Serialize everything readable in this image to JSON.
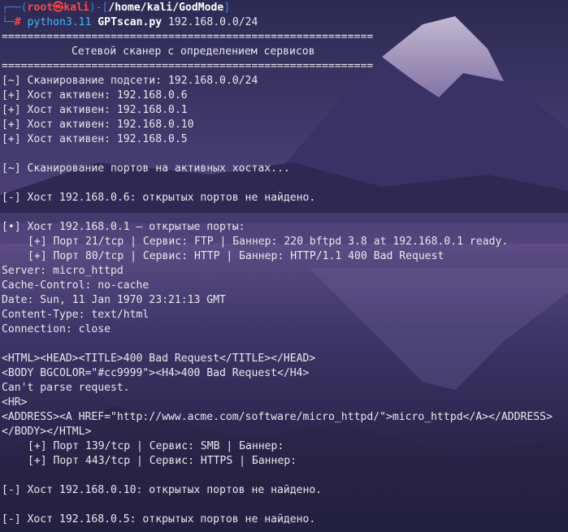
{
  "prompt": {
    "user": "root",
    "at": "㉿",
    "host": "kali",
    "cwd": "/home/kali/GodMode",
    "symbol": "#"
  },
  "command": {
    "interpreter": "python3.11",
    "script": "GPTscan.py",
    "argument": "192.168.0.0/24"
  },
  "banner": {
    "separator": "==========================================================",
    "title": "Сетевой сканер с определением сервисов"
  },
  "output": {
    "scan_subnet": "[~] Сканирование подсети: 192.168.0.0/24",
    "hosts": [
      "[+] Хост активен: 192.168.0.6",
      "[+] Хост активен: 192.168.0.1",
      "[+] Хост активен: 192.168.0.10",
      "[+] Хост активен: 192.168.0.5"
    ],
    "scan_ports": "[~] Сканирование портов на активных хостах...",
    "host_6_none": "[-] Хост 192.168.0.6: открытых портов не найдено.",
    "host_1_header": "[•] Хост 192.168.0.1 — открытые порты:",
    "port_21": "[+] Порт 21/tcp | Сервис: FTP | Баннер: 220 bftpd 3.8 at 192.168.0.1 ready.",
    "port_80": "[+] Порт 80/tcp | Сервис: HTTP | Баннер: HTTP/1.1 400 Bad Request",
    "http_lines": [
      "Server: micro_httpd",
      "Cache-Control: no-cache",
      "Date: Sun, 11 Jan 1970 23:21:13 GMT",
      "Content-Type: text/html",
      "Connection: close"
    ],
    "html_lines": [
      "<HTML><HEAD><TITLE>400 Bad Request</TITLE></HEAD>",
      "<BODY BGCOLOR=\"#cc9999\"><H4>400 Bad Request</H4>",
      "Can't parse request.",
      "<HR>",
      "<ADDRESS><A HREF=\"http://www.acme.com/software/micro_httpd/\">micro_httpd</A></ADDRESS>",
      "</BODY></HTML>"
    ],
    "port_139": "[+] Порт 139/tcp | Сервис: SMB | Баннер:",
    "port_443": "[+] Порт 443/tcp | Сервис: HTTPS | Баннер:",
    "host_10_none": "[-] Хост 192.168.0.10: открытых портов не найдено.",
    "host_5_none": "[-] Хост 192.168.0.5: открытых портов не найдено."
  },
  "colors": {
    "prompt_frame": "#3b7fe6",
    "prompt_user": "#ff4848",
    "command_interpreter": "#42b8ff",
    "text": "#e8e8ee"
  }
}
